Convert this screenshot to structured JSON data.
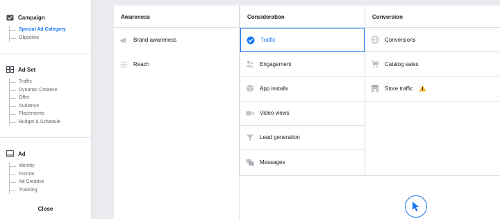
{
  "sidebar": {
    "campaign": {
      "title": "Campaign",
      "items": [
        "Special Ad Category",
        "Objective"
      ],
      "active_index": 0
    },
    "adset": {
      "title": "Ad Set",
      "items": [
        "Traffic",
        "Dynamic Creative",
        "Offer",
        "Audience",
        "Placements",
        "Budget & Schedule"
      ]
    },
    "ad": {
      "title": "Ad",
      "items": [
        "Identity",
        "Format",
        "Ad Creative",
        "Tracking"
      ]
    },
    "close_label": "Close"
  },
  "objectives": {
    "columns": [
      {
        "title": "Awareness",
        "items": [
          {
            "label": "Brand awareness",
            "icon": "megaphone-icon"
          },
          {
            "label": "Reach",
            "icon": "reach-icon"
          }
        ]
      },
      {
        "title": "Consideration",
        "items": [
          {
            "label": "Traffic",
            "icon": "check-circle-icon",
            "selected": true
          },
          {
            "label": "Engagement",
            "icon": "people-icon"
          },
          {
            "label": "App installs",
            "icon": "box-icon"
          },
          {
            "label": "Video views",
            "icon": "video-camera-icon"
          },
          {
            "label": "Lead generation",
            "icon": "funnel-icon"
          },
          {
            "label": "Messages",
            "icon": "chat-bubbles-icon"
          }
        ]
      },
      {
        "title": "Conversion",
        "items": [
          {
            "label": "Conversions",
            "icon": "globe-icon"
          },
          {
            "label": "Catalog sales",
            "icon": "shopping-cart-icon"
          },
          {
            "label": "Store traffic",
            "icon": "store-icon",
            "warning": true
          }
        ]
      }
    ]
  },
  "colors": {
    "accent": "#1877f2",
    "warning": "#f7b928",
    "icon_gray": "#bec3c9"
  }
}
